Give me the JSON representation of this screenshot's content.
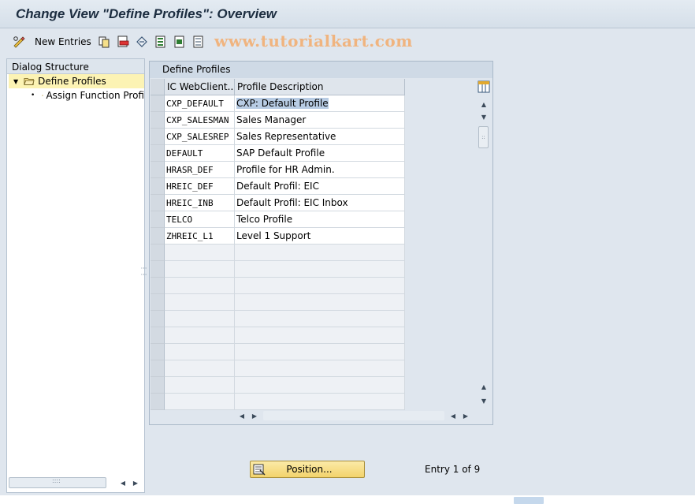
{
  "window": {
    "title": "Change View \"Define Profiles\": Overview"
  },
  "toolbar": {
    "new_entries_label": "New Entries",
    "icons": [
      "edit-glasses-icon",
      "copy-icon",
      "delete-icon",
      "undo-change-icon",
      "select-all-icon",
      "select-block-icon",
      "deselect-all-icon"
    ],
    "watermark": "www.tutorialkart.com"
  },
  "dialog_structure": {
    "header": "Dialog Structure",
    "items": [
      {
        "label": "Define Profiles",
        "selected": true,
        "expanded": true,
        "icon": "open-folder-icon"
      },
      {
        "label": "Assign Function Profi",
        "selected": false,
        "icon": "folder-icon"
      }
    ]
  },
  "table": {
    "title": "Define Profiles",
    "columns": [
      "IC WebClient...",
      "Profile Description"
    ],
    "rows": [
      {
        "profile": "CXP_DEFAULT",
        "description": "CXP: Default Profile"
      },
      {
        "profile": "CXP_SALESMAN",
        "description": "Sales Manager"
      },
      {
        "profile": "CXP_SALESREP",
        "description": "Sales Representative"
      },
      {
        "profile": "DEFAULT",
        "description": "SAP Default Profile"
      },
      {
        "profile": "HRASR_DEF",
        "description": "Profile for HR Admin."
      },
      {
        "profile": "HREIC_DEF",
        "description": "Default Profil: EIC"
      },
      {
        "profile": "HREIC_INB",
        "description": "Default Profil: EIC Inbox"
      },
      {
        "profile": "TELCO",
        "description": "Telco Profile"
      },
      {
        "profile": "ZHREIC_L1",
        "description": "Level 1 Support"
      }
    ],
    "empty_row_count": 10,
    "highlighted_cell": "CXP: Default Profile"
  },
  "footer": {
    "position_button": "Position...",
    "entry_text": "Entry 1 of 9"
  },
  "colors": {
    "background": "#dfe6ee",
    "selection_yellow": "#fcf3b4",
    "cell_highlight": "#b8cce4",
    "button_yellow": "#f3d36b"
  }
}
